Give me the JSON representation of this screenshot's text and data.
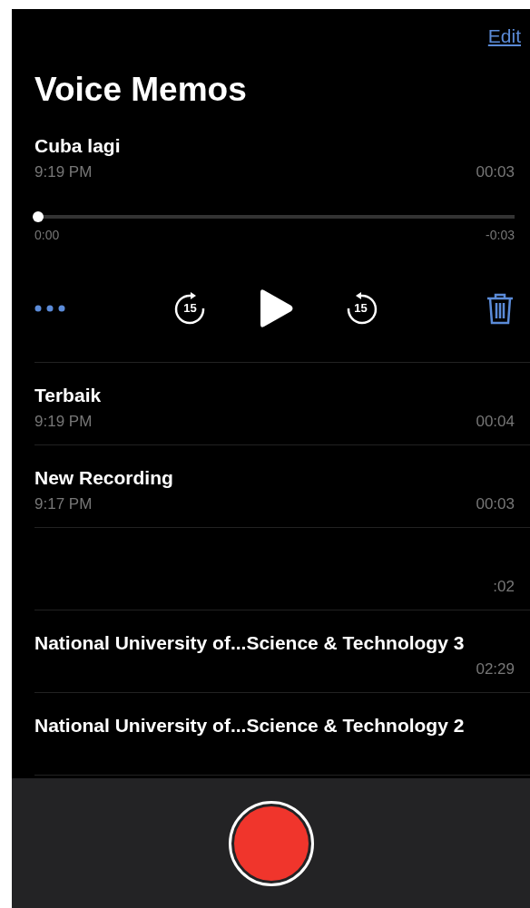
{
  "nav": {
    "edit": "Edit"
  },
  "title": "Voice Memos",
  "recordings": [
    {
      "name": "Cuba lagi",
      "date": "9:19 PM",
      "duration": "00:03",
      "expanded": true,
      "player": {
        "level": 0,
        "elapsed": "0:00",
        "remaining": "-0:03",
        "skip_back": "15",
        "skip_forward": "15"
      }
    },
    {
      "name": "Terbaik",
      "date": "9:19 PM",
      "duration": "00:04",
      "expanded": false
    },
    {
      "name": "New Recording",
      "date": "9:17 PM",
      "duration": "00:03",
      "expanded": false
    },
    {
      "duration": ":02",
      "expanded": false
    },
    {
      "name": "National University of...Science & Technology 3",
      "duration": "02:29",
      "expanded": false
    },
    {
      "name": "National University of...Science & Technology 2",
      "expanded": false
    }
  ]
}
